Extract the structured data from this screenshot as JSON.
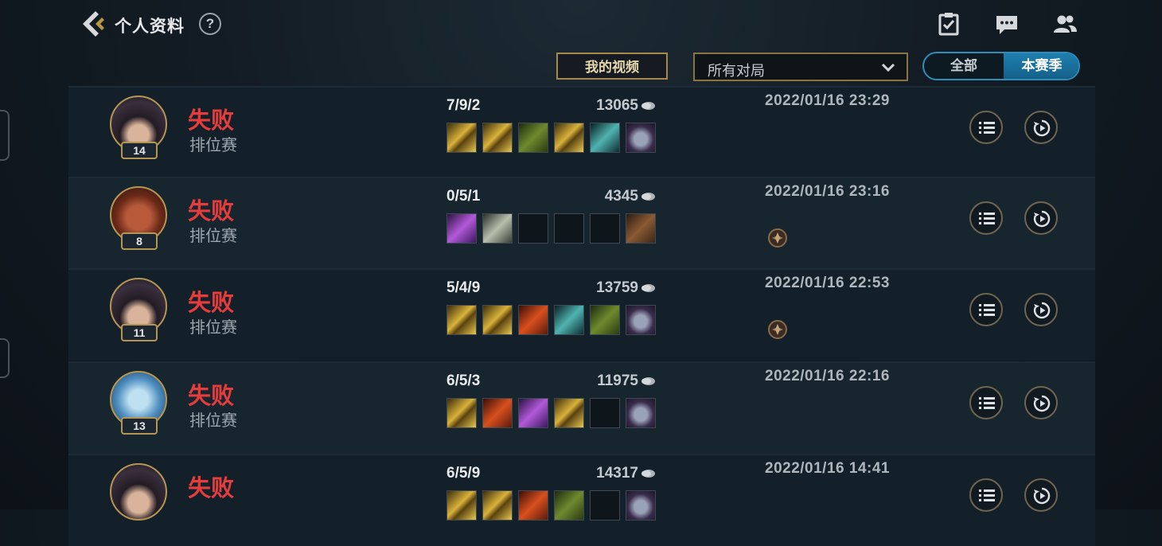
{
  "header": {
    "title": "个人资料",
    "help": "?"
  },
  "toolbar": {
    "video_button": "我的视频",
    "filter_value": "所有对局",
    "toggle_all": "全部",
    "toggle_season": "本赛季"
  },
  "matches": [
    {
      "result": "失败",
      "mode": "排位赛",
      "level": "14",
      "kda": "7/9/2",
      "gold": "13065",
      "date": "2022/01/16 23:29",
      "honor": false,
      "items": [
        "gold",
        "gold",
        "green",
        "gold",
        "teal",
        "purple"
      ]
    },
    {
      "result": "失败",
      "mode": "排位赛",
      "level": "8",
      "kda": "0/5/1",
      "gold": "4345",
      "date": "2022/01/16 23:16",
      "honor": true,
      "items": [
        "violet",
        "silver",
        "empty",
        "empty",
        "empty",
        "brown"
      ]
    },
    {
      "result": "失败",
      "mode": "排位赛",
      "level": "11",
      "kda": "5/4/9",
      "gold": "13759",
      "date": "2022/01/16 22:53",
      "honor": true,
      "items": [
        "gold",
        "gold",
        "red",
        "teal",
        "green",
        "purple"
      ]
    },
    {
      "result": "失败",
      "mode": "排位赛",
      "level": "13",
      "kda": "6/5/3",
      "gold": "11975",
      "date": "2022/01/16 22:16",
      "honor": false,
      "items": [
        "gold",
        "red",
        "violet",
        "gold",
        "empty",
        "purple"
      ]
    },
    {
      "result": "失败",
      "mode": "",
      "level": "",
      "kda": "6/5/9",
      "gold": "14317",
      "date": "2022/01/16 14:41",
      "honor": false,
      "items": [
        "gold",
        "gold",
        "red",
        "green",
        "empty",
        "purple"
      ]
    }
  ],
  "colors": {
    "defeat": "#e63c3c",
    "accent_gold": "#b39654",
    "season_blue": "#1f7fb0"
  },
  "icons": [
    "back-arrow-icon",
    "help-icon",
    "task-clipboard-icon",
    "chat-icon",
    "friends-icon",
    "chevron-down-icon",
    "gold-coin-icon",
    "honor-badge-icon",
    "details-list-icon",
    "replay-icon"
  ]
}
